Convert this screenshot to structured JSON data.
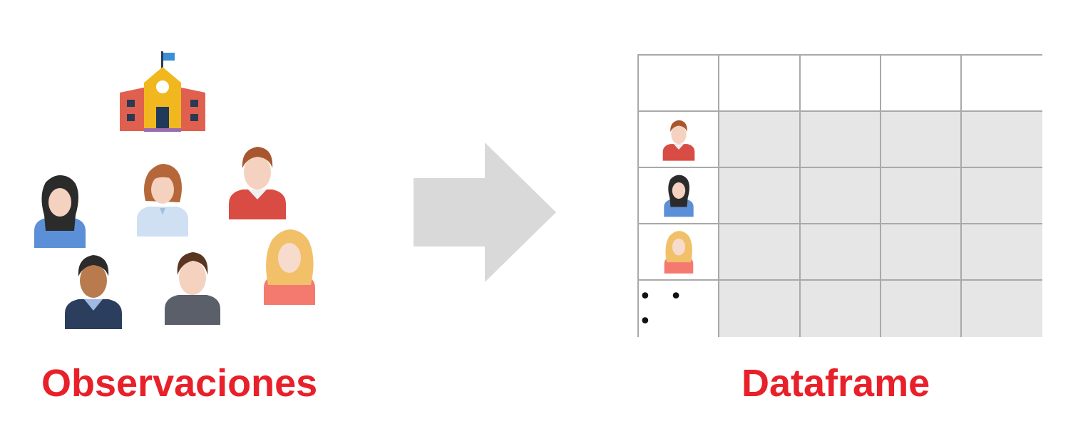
{
  "labels": {
    "left_caption": "Observaciones",
    "right_caption": "Dataframe"
  },
  "table": {
    "row_marker_ellipsis": "• • •"
  },
  "icons": {
    "school": "school-icon",
    "people": [
      "woman-dark-hair-icon",
      "woman-brown-hair-icon",
      "man-red-sweater-icon",
      "woman-blonde-icon",
      "man-dark-skin-icon",
      "man-gray-sweater-icon"
    ],
    "arrow": "right-arrow-icon"
  },
  "colors": {
    "caption": "#e8202a",
    "arrow": "#d9d9d9",
    "table_border": "#a9a9a9",
    "table_fill": "#e6e6e6"
  }
}
